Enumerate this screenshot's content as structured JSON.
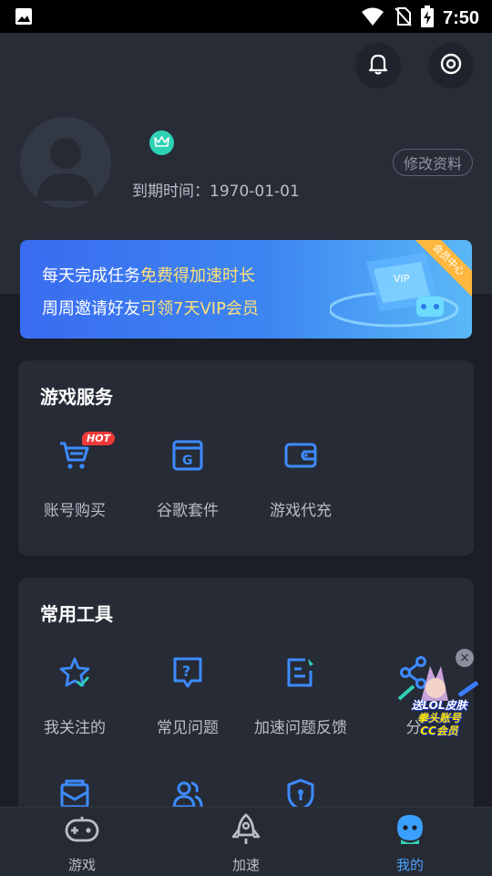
{
  "status_bar": {
    "time": "7:50"
  },
  "profile": {
    "expiry_label": "到期时间：",
    "expiry_date": "1970-01-01",
    "edit_button": "修改资料"
  },
  "banner": {
    "line1_prefix": "每天完成任务",
    "line1_highlight": "免费得加速时长",
    "line2_prefix": "周周邀请好友",
    "line2_highlight": "可领7天VIP会员",
    "ribbon": "会员中心",
    "art_text": "VIP"
  },
  "game_services": {
    "title": "游戏服务",
    "items": [
      {
        "label": "账号购买",
        "icon": "cart-icon",
        "badge": "HOT"
      },
      {
        "label": "谷歌套件",
        "icon": "google-suite-icon"
      },
      {
        "label": "游戏代充",
        "icon": "wallet-icon"
      }
    ]
  },
  "tools": {
    "title": "常用工具",
    "items": [
      {
        "label": "我关注的",
        "icon": "star-check-icon"
      },
      {
        "label": "常见问题",
        "icon": "question-icon"
      },
      {
        "label": "加速问题反馈",
        "icon": "feedback-icon"
      },
      {
        "label": "分",
        "icon": "share-icon"
      }
    ],
    "row2_icons": [
      "mail-icon",
      "users-icon",
      "shield-icon"
    ]
  },
  "floating_ad": {
    "line1": "送LOL皮肤",
    "line2": "拳头账号",
    "line3": "CC会员"
  },
  "tab_bar": {
    "tabs": [
      {
        "label": "游戏",
        "icon": "gamepad-icon"
      },
      {
        "label": "加速",
        "icon": "rocket-icon"
      },
      {
        "label": "我的",
        "icon": "profile-mascot-icon",
        "active": true
      }
    ]
  },
  "colors": {
    "accent": "#4aa2ff",
    "background": "#1b1e26",
    "card": "#262b36",
    "crown": "#2fd1b4",
    "hot_badge": "#f03a3a",
    "highlight_text": "#ffe07a"
  }
}
